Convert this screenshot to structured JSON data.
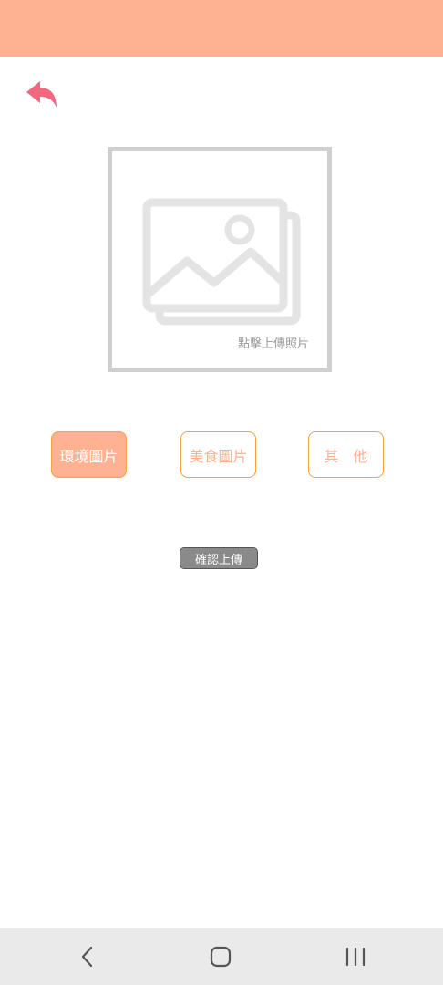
{
  "header": {
    "color": "#ffb292"
  },
  "back_button": {
    "icon": "undo-arrow-icon",
    "color": "#f2687e"
  },
  "photo_upload": {
    "icon": "image-placeholder-icon",
    "hint": "點擊上傳照片"
  },
  "categories": [
    {
      "label": "環境圖片",
      "selected": true
    },
    {
      "label": "美食圖片",
      "selected": false
    },
    {
      "label": "其　他",
      "selected": false
    }
  ],
  "confirm": {
    "label": "確認上傳"
  },
  "system_nav": {
    "back_icon": "chevron-left-icon",
    "home_icon": "home-icon",
    "recent_icon": "recent-apps-icon"
  }
}
